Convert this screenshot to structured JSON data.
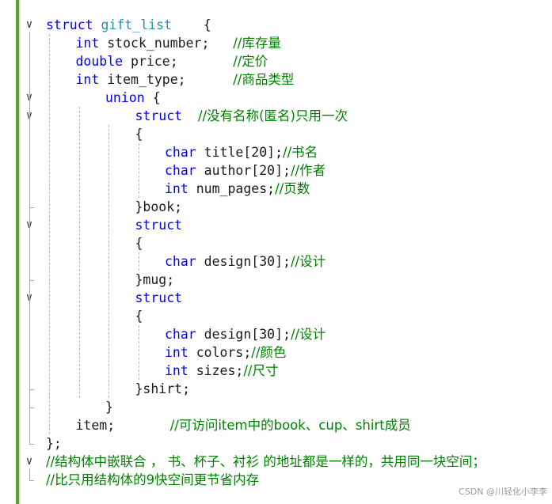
{
  "code_lines": [
    {
      "indent": 0,
      "fold": "chevron",
      "tokens": [
        {
          "t": "kw",
          "v": "struct "
        },
        {
          "t": "ty",
          "v": "gift_list"
        },
        {
          "t": "id",
          "v": "    {"
        }
      ]
    },
    {
      "indent": 1,
      "fold": "",
      "tokens": [
        {
          "t": "kw",
          "v": "int "
        },
        {
          "t": "id",
          "v": "stock_number;   "
        },
        {
          "t": "cm",
          "v": "//库存量"
        }
      ]
    },
    {
      "indent": 1,
      "fold": "",
      "tokens": [
        {
          "t": "kw",
          "v": "double "
        },
        {
          "t": "id",
          "v": "price;       "
        },
        {
          "t": "cm",
          "v": "//定价"
        }
      ]
    },
    {
      "indent": 1,
      "fold": "",
      "tokens": [
        {
          "t": "kw",
          "v": "int "
        },
        {
          "t": "id",
          "v": "item_type;      "
        },
        {
          "t": "cm",
          "v": "//商品类型"
        }
      ]
    },
    {
      "indent": 2,
      "fold": "chevron",
      "tokens": [
        {
          "t": "kw",
          "v": "union "
        },
        {
          "t": "id",
          "v": "{"
        }
      ]
    },
    {
      "indent": 3,
      "fold": "chevron",
      "tokens": [
        {
          "t": "kw",
          "v": "struct  "
        },
        {
          "t": "cm",
          "v": "//没有名称(匿名)只用一次"
        }
      ]
    },
    {
      "indent": 3,
      "fold": "",
      "tokens": [
        {
          "t": "id",
          "v": "{"
        }
      ]
    },
    {
      "indent": 4,
      "fold": "",
      "tokens": [
        {
          "t": "kw",
          "v": "char "
        },
        {
          "t": "id",
          "v": "title[20];"
        },
        {
          "t": "cm",
          "v": "//书名"
        }
      ]
    },
    {
      "indent": 4,
      "fold": "",
      "tokens": [
        {
          "t": "kw",
          "v": "char "
        },
        {
          "t": "id",
          "v": "author[20];"
        },
        {
          "t": "cm",
          "v": "//作者"
        }
      ]
    },
    {
      "indent": 4,
      "fold": "",
      "tokens": [
        {
          "t": "kw",
          "v": "int "
        },
        {
          "t": "id",
          "v": "num_pages;"
        },
        {
          "t": "cm",
          "v": "//页数"
        }
      ]
    },
    {
      "indent": 3,
      "fold": "",
      "tokens": [
        {
          "t": "id",
          "v": "}book;"
        }
      ]
    },
    {
      "indent": 3,
      "fold": "chevron",
      "tokens": [
        {
          "t": "kw",
          "v": "struct"
        }
      ]
    },
    {
      "indent": 3,
      "fold": "",
      "tokens": [
        {
          "t": "id",
          "v": "{"
        }
      ]
    },
    {
      "indent": 4,
      "fold": "",
      "tokens": [
        {
          "t": "kw",
          "v": "char "
        },
        {
          "t": "id",
          "v": "design[30];"
        },
        {
          "t": "cm",
          "v": "//设计"
        }
      ]
    },
    {
      "indent": 3,
      "fold": "",
      "tokens": [
        {
          "t": "id",
          "v": "}mug;"
        }
      ]
    },
    {
      "indent": 3,
      "fold": "chevron",
      "tokens": [
        {
          "t": "kw",
          "v": "struct"
        }
      ]
    },
    {
      "indent": 3,
      "fold": "",
      "tokens": [
        {
          "t": "id",
          "v": "{"
        }
      ]
    },
    {
      "indent": 4,
      "fold": "",
      "tokens": [
        {
          "t": "kw",
          "v": "char "
        },
        {
          "t": "id",
          "v": "design[30];"
        },
        {
          "t": "cm",
          "v": "//设计"
        }
      ]
    },
    {
      "indent": 4,
      "fold": "",
      "tokens": [
        {
          "t": "kw",
          "v": "int "
        },
        {
          "t": "id",
          "v": "colors;"
        },
        {
          "t": "cm",
          "v": "//颜色"
        }
      ]
    },
    {
      "indent": 4,
      "fold": "",
      "tokens": [
        {
          "t": "kw",
          "v": "int "
        },
        {
          "t": "id",
          "v": "sizes;"
        },
        {
          "t": "cm",
          "v": "//尺寸"
        }
      ]
    },
    {
      "indent": 3,
      "fold": "",
      "tokens": [
        {
          "t": "id",
          "v": "}shirt;"
        }
      ]
    },
    {
      "indent": 2,
      "fold": "",
      "tokens": [
        {
          "t": "id",
          "v": "}"
        }
      ]
    },
    {
      "indent": 1,
      "fold": "",
      "tokens": [
        {
          "t": "id",
          "v": "item;       "
        },
        {
          "t": "cm",
          "v": "//可访问item中的book、cup、shirt成员"
        }
      ]
    },
    {
      "indent": 0,
      "fold": "",
      "tokens": [
        {
          "t": "id",
          "v": "};"
        }
      ]
    },
    {
      "indent": 0,
      "fold": "chevron",
      "tokens": [
        {
          "t": "cm",
          "v": "//结构体中嵌联合 ， 书、杯子、衬衫 的地址都是一样的，共用同一块空间；"
        }
      ]
    },
    {
      "indent": 0,
      "fold": "",
      "tokens": [
        {
          "t": "cm",
          "v": "//比只用结构体的9快空间更节省内存"
        }
      ]
    }
  ],
  "watermark": "CSDN @川轻化小李李",
  "colors": {
    "keyword": "#0000ff",
    "comment": "#008000",
    "identifier": "#1a1a1a",
    "type_name": "#2b91af",
    "change_bar": "#5a9e3f"
  },
  "fold_icon": "chevron-down-icon"
}
